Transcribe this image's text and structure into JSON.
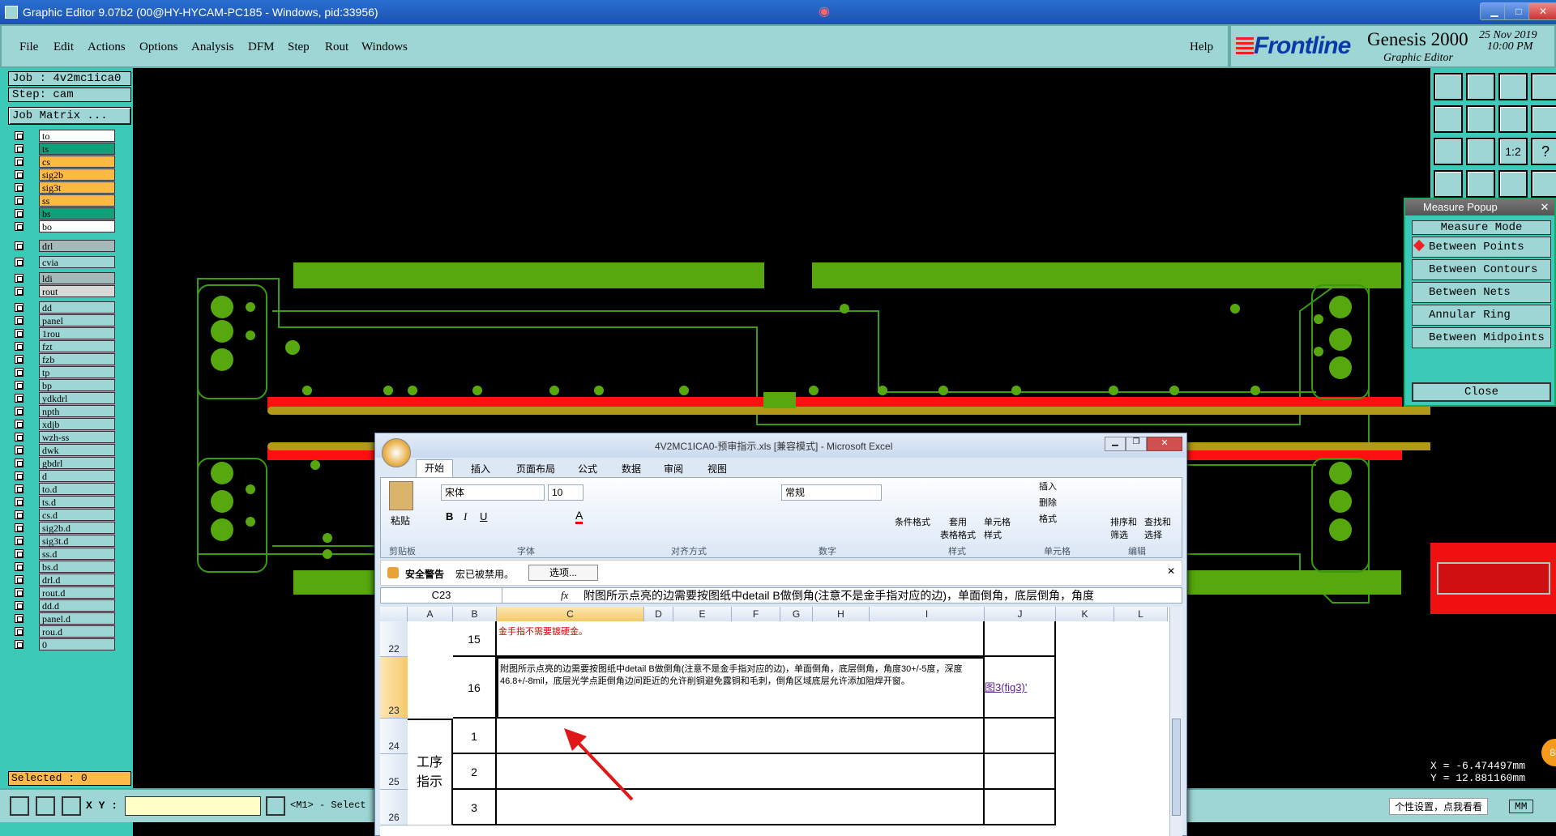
{
  "window": {
    "title": "Graphic Editor 9.07b2 (00@HY-HYCAM-PC185 - Windows, pid:33956)"
  },
  "menu": [
    "File",
    "Edit",
    "Actions",
    "Options",
    "Analysis",
    "DFM",
    "Step",
    "Rout",
    "Windows"
  ],
  "help_label": "Help",
  "brand": {
    "logo": "Frontline",
    "product": "Genesis 2000",
    "subtitle": "Graphic Editor",
    "date": "25 Nov 2019",
    "time": "10:00 PM"
  },
  "job": {
    "job_line": "Job : 4v2mc1ica0",
    "step_line": "Step: cam",
    "matrix_button": "Job Matrix ..."
  },
  "layers": [
    {
      "name": "to",
      "color": "#ffffff"
    },
    {
      "name": "ts",
      "color": "#11a07a"
    },
    {
      "name": "cs",
      "color": "#ffb84a"
    },
    {
      "name": "sig2b",
      "color": "#ffb84a"
    },
    {
      "name": "sig3t",
      "color": "#ffb84a"
    },
    {
      "name": "ss",
      "color": "#ffb84a"
    },
    {
      "name": "bs",
      "color": "#11a07a"
    },
    {
      "name": "bo",
      "color": "#ffffff"
    },
    {
      "name": "drl",
      "color": "#a8b8b8"
    },
    {
      "name": "cvia",
      "color": "#9ed6d6"
    },
    {
      "name": "ldi",
      "color": "#a8b8b8"
    },
    {
      "name": "rout",
      "color": "#d8d8d8"
    },
    {
      "name": "dd",
      "color": "#9ed6d6"
    },
    {
      "name": "panel",
      "color": "#9ed6d6"
    },
    {
      "name": "1rou",
      "color": "#9ed6d6"
    },
    {
      "name": "fzt",
      "color": "#9ed6d6"
    },
    {
      "name": "fzb",
      "color": "#9ed6d6"
    },
    {
      "name": "tp",
      "color": "#9ed6d6"
    },
    {
      "name": "bp",
      "color": "#9ed6d6"
    },
    {
      "name": "ydkdrl",
      "color": "#9ed6d6"
    },
    {
      "name": "npth",
      "color": "#9ed6d6"
    },
    {
      "name": "xdjb",
      "color": "#9ed6d6"
    },
    {
      "name": "wzh-ss",
      "color": "#9ed6d6"
    },
    {
      "name": "dwk",
      "color": "#9ed6d6"
    },
    {
      "name": "gbdrl",
      "color": "#9ed6d6"
    },
    {
      "name": "d",
      "color": "#9ed6d6"
    },
    {
      "name": "to.d",
      "color": "#9ed6d6"
    },
    {
      "name": "ts.d",
      "color": "#9ed6d6"
    },
    {
      "name": "cs.d",
      "color": "#9ed6d6"
    },
    {
      "name": "sig2b.d",
      "color": "#9ed6d6"
    },
    {
      "name": "sig3t.d",
      "color": "#9ed6d6"
    },
    {
      "name": "ss.d",
      "color": "#9ed6d6"
    },
    {
      "name": "bs.d",
      "color": "#9ed6d6"
    },
    {
      "name": "drl.d",
      "color": "#9ed6d6"
    },
    {
      "name": "rout.d",
      "color": "#9ed6d6"
    },
    {
      "name": "dd.d",
      "color": "#9ed6d6"
    },
    {
      "name": "panel.d",
      "color": "#9ed6d6"
    },
    {
      "name": "rou.d",
      "color": "#9ed6d6"
    },
    {
      "name": "0",
      "color": "#9ed6d6"
    }
  ],
  "selected_label": "Selected : 0",
  "bottom": {
    "xy_label": "X Y :",
    "mode": "<M1> - Select",
    "units": "MM",
    "tooltip": "个性设置，点我看看"
  },
  "coords": {
    "x": "X = -6.474497mm",
    "y": "Y = 12.881160mm"
  },
  "measure": {
    "title": "Measure Popup",
    "mode_label": "Measure Mode",
    "options": [
      "Between Points",
      "Between Contours",
      "Between Nets",
      "Annular Ring",
      "Between Midpoints"
    ],
    "close_label": "Close"
  },
  "excel": {
    "title": "4V2MC1ICA0-预审指示.xls  [兼容模式] - Microsoft Excel",
    "tabs": [
      "开始",
      "插入",
      "页面布局",
      "公式",
      "数据",
      "审阅",
      "视图"
    ],
    "font_name": "宋体",
    "font_size": "10",
    "number_format": "常规",
    "groups": [
      "剪贴板",
      "字体",
      "对齐方式",
      "数字",
      "样式",
      "单元格",
      "编辑"
    ],
    "paste_label": "粘贴",
    "style_buttons": [
      "条件格式",
      "套用\n表格格式",
      "单元格\n样式"
    ],
    "cell_buttons": [
      "插入",
      "删除",
      "格式"
    ],
    "edit_buttons": [
      "排序和\n筛选",
      "查找和\n选择"
    ],
    "security": {
      "title": "安全警告",
      "text": "宏已被禁用。",
      "button": "选项..."
    },
    "name_box": "C23",
    "formula": "附图所示点亮的边需要按图纸中detail B做倒角(注意不是金手指对应的边)，单面倒角，底层倒角，角度",
    "columns": [
      "A",
      "B",
      "C",
      "D",
      "E",
      "F",
      "G",
      "H",
      "I",
      "J",
      "K",
      "L"
    ],
    "rows": [
      {
        "num": "22",
        "b": "15",
        "c": "金手指不需要镀硬金。",
        "j": ""
      },
      {
        "num": "23",
        "b": "16",
        "c": "附图所示点亮的边需要按图纸中detail B做倒角(注意不是金手指对应的边)，单面倒角，底层倒角，角度30+/-5度，深度46.8+/-8mil，底层光学点距倒角边间距近的允许削铜避免露铜和毛刺，倒角区域底层允许添加阻焊开窗。",
        "j": "图3(fig3)'"
      },
      {
        "num": "24",
        "b": "1",
        "c": "",
        "j": ""
      },
      {
        "num": "25",
        "b": "2",
        "c": "",
        "j": ""
      },
      {
        "num": "26",
        "b": "3",
        "c": "",
        "j": ""
      }
    ],
    "merged_label": "工序\n指示"
  }
}
